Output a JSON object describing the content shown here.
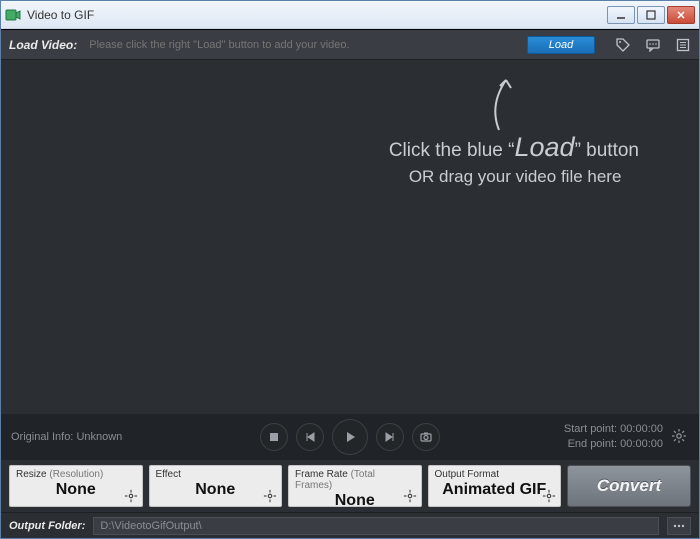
{
  "window": {
    "title": "Video to GIF"
  },
  "loadbar": {
    "label": "Load Video:",
    "placeholder": "Please click the right \"Load\" button to add your video.",
    "load_button": "Load"
  },
  "overlay": {
    "line1_pre": "Click the blue “",
    "line1_big": "Load",
    "line1_post": "” button",
    "line2": "OR drag your video file here"
  },
  "controls": {
    "original_info_label": "Original Info:",
    "original_info_value": "Unknown",
    "start_label": "Start point:",
    "start_value": "00:00:00",
    "end_label": "End point:",
    "end_value": "00:00:00"
  },
  "options": {
    "resize": {
      "caption": "Resize",
      "sub": "(Resolution)",
      "value": "None"
    },
    "effect": {
      "caption": "Effect",
      "value": "None"
    },
    "framerate": {
      "caption": "Frame Rate",
      "sub": "(Total Frames)",
      "value": "None"
    },
    "format": {
      "caption": "Output Format",
      "value": "Animated GIF"
    },
    "convert_label": "Convert"
  },
  "output": {
    "label": "Output Folder:",
    "path": "D:\\VideotoGifOutput\\"
  }
}
